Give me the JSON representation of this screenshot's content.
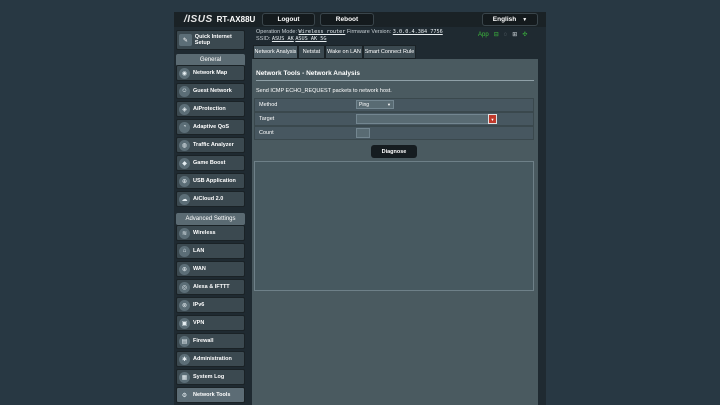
{
  "header": {
    "logo": "/ISUS",
    "model": "RT-AX88U",
    "logout": "Logout",
    "reboot": "Reboot",
    "language": "English"
  },
  "info": {
    "op_mode_label": "Operation Mode:",
    "op_mode_value": "Wireless router",
    "fw_label": "Firmware Version:",
    "fw_value": "3.0.0.4.384_7756",
    "ssid_label": "SSID:",
    "ssid_1": "ASUS_AK",
    "ssid_2": "ASUS_AK_5G",
    "app_label": "App"
  },
  "sidebar": {
    "qis": "Quick Internet Setup",
    "general_header": "General",
    "general": [
      {
        "label": "Network Map",
        "icon": "network-map-icon"
      },
      {
        "label": "Guest Network",
        "icon": "guest-network-icon"
      },
      {
        "label": "AiProtection",
        "icon": "aiprotection-icon"
      },
      {
        "label": "Adaptive QoS",
        "icon": "qos-icon"
      },
      {
        "label": "Traffic Analyzer",
        "icon": "traffic-analyzer-icon"
      },
      {
        "label": "Game Boost",
        "icon": "gamepad-icon"
      },
      {
        "label": "USB Application",
        "icon": "usb-icon"
      },
      {
        "label": "AiCloud 2.0",
        "icon": "cloud-icon"
      }
    ],
    "advanced_header": "Advanced Settings",
    "advanced": [
      {
        "label": "Wireless",
        "icon": "wireless-icon"
      },
      {
        "label": "LAN",
        "icon": "lan-icon"
      },
      {
        "label": "WAN",
        "icon": "wan-icon"
      },
      {
        "label": "Alexa & IFTTT",
        "icon": "alexa-icon"
      },
      {
        "label": "IPv6",
        "icon": "ipv6-icon"
      },
      {
        "label": "VPN",
        "icon": "vpn-icon"
      },
      {
        "label": "Firewall",
        "icon": "firewall-icon"
      },
      {
        "label": "Administration",
        "icon": "administration-icon"
      },
      {
        "label": "System Log",
        "icon": "system-log-icon"
      },
      {
        "label": "Network Tools",
        "icon": "network-tools-icon"
      }
    ]
  },
  "tabs": [
    "Network Analysis",
    "Netstat",
    "Wake on LAN",
    "Smart Connect Rule"
  ],
  "main": {
    "title": "Network Tools - Network Analysis",
    "description": "Send ICMP ECHO_REQUEST packets to network host.",
    "method_label": "Method",
    "method_value": "Ping",
    "target_label": "Target",
    "target_placeholder": "",
    "count_label": "Count",
    "diagnose": "Diagnose"
  },
  "colors": {
    "background": "#283843",
    "panel": "#4a5a60",
    "status_green": "#3dbd3d"
  }
}
